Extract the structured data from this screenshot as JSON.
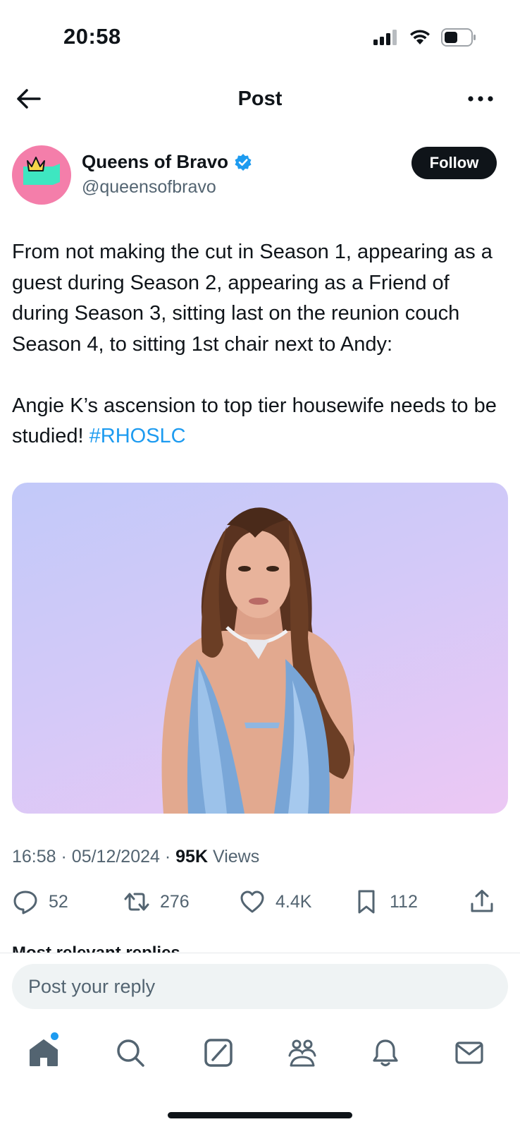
{
  "status_bar": {
    "time": "20:58"
  },
  "header": {
    "title": "Post"
  },
  "author": {
    "name": "Queens of Bravo",
    "handle": "@queensofbravo",
    "follow_label": "Follow"
  },
  "post": {
    "paragraph1": "From not making the cut in Season 1, appearing as a guest during Season 2, appearing as a Friend of during Season 3, sitting last on the reunion couch Season 4, to sitting 1st chair next to Andy:",
    "paragraph2": "Angie K’s ascension to top tier housewife needs to be studied!",
    "hashtag": "#RHOSLC"
  },
  "meta": {
    "time": "16:58",
    "date": "05/12/2024",
    "views_count": "95K",
    "views_label": "Views"
  },
  "actions": {
    "replies": "52",
    "reposts": "276",
    "likes": "4.4K",
    "bookmarks": "112"
  },
  "replies_section": {
    "heading": "Most relevant replies"
  },
  "reply_box": {
    "placeholder": "Post your reply"
  },
  "colors": {
    "accent": "#1d9bf0",
    "text": "#0f1419",
    "muted": "#536471",
    "avatar_bg": "#f47eaa",
    "avatar_flag": "#3ee6c1",
    "crown": "#f6d54a"
  },
  "icons": {
    "back": "arrow-left-icon",
    "more": "more-horizontal-icon",
    "verified": "verified-badge-icon",
    "reply": "reply-icon",
    "repost": "repost-icon",
    "like": "heart-icon",
    "bookmark": "bookmark-icon",
    "share": "share-icon",
    "nav": [
      "home-icon",
      "search-icon",
      "grok-icon",
      "communities-icon",
      "notifications-icon",
      "messages-icon"
    ]
  }
}
